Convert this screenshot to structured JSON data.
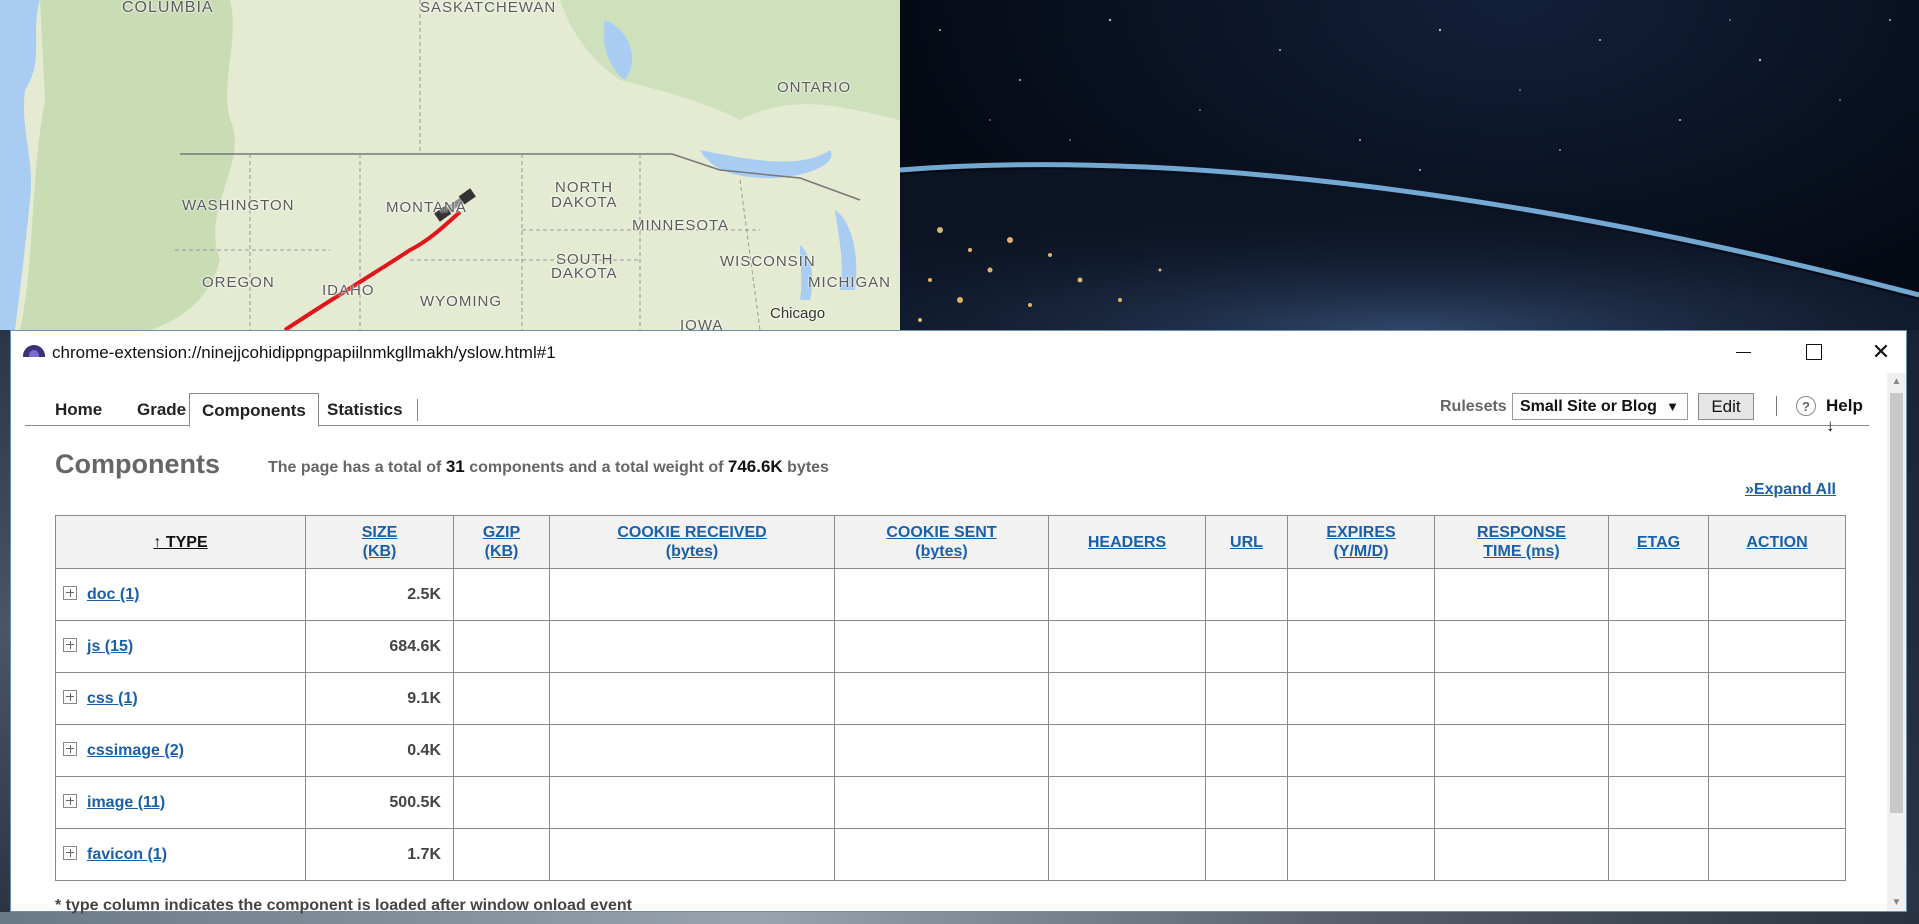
{
  "map": {
    "labels": {
      "columbia": "COLUMBIA",
      "saskatchewan": "SASKATCHEWAN",
      "ontario": "ONTARIO",
      "washington": "WASHINGTON",
      "montana": "MONTANA",
      "north_dakota_1": "NORTH",
      "north_dakota_2": "DAKOTA",
      "minnesota": "MINNESOTA",
      "south_dakota_1": "SOUTH",
      "south_dakota_2": "DAKOTA",
      "wisconsin": "WISCONSIN",
      "oregon": "OREGON",
      "idaho": "IDAHO",
      "wyoming": "WYOMING",
      "michigan": "MICHIGAN",
      "iowa": "IOWA",
      "chicago": "Chicago"
    }
  },
  "window": {
    "title": "chrome-extension://ninejjcohidippngpapiilnmkgllmakh/yslow.html#1",
    "controls": {
      "minimize": "",
      "maximize": "",
      "close": "✕"
    }
  },
  "tabs": {
    "home": "Home",
    "grade": "Grade",
    "components": "Components",
    "statistics": "Statistics"
  },
  "toolbar": {
    "rulesets_label": "Rulesets",
    "ruleset_selected": "Small Site or Blog",
    "ruleset_arrow": "▼",
    "edit_label": "Edit",
    "help_icon": "?",
    "help_label": "Help ↓"
  },
  "content": {
    "title": "Components",
    "summary_prefix": "The page has a total of",
    "component_count": "31",
    "summary_mid": "components and a total weight of",
    "total_weight": "746.6K",
    "summary_suffix": "bytes",
    "expand_all": "»Expand All",
    "footnote": "* type column indicates the component is loaded after window onload event"
  },
  "table": {
    "headers": {
      "type": "↑ TYPE",
      "size_1": "SIZE",
      "size_2": "(KB)",
      "gzip_1": "GZIP",
      "gzip_2": "(KB)",
      "cookie_received_1": "COOKIE RECEIVED",
      "cookie_received_2": "(bytes)",
      "cookie_sent_1": "COOKIE SENT",
      "cookie_sent_2": "(bytes)",
      "headers": "HEADERS",
      "url": "URL",
      "expires_1": "EXPIRES",
      "expires_2": "(Y/M/D)",
      "response_1": "RESPONSE",
      "response_2": "TIME (ms)",
      "etag": "ETAG",
      "action": "ACTION"
    },
    "rows": [
      {
        "type": "doc (1)",
        "size": "2.5K"
      },
      {
        "type": "js (15)",
        "size": "684.6K"
      },
      {
        "type": "css (1)",
        "size": "9.1K"
      },
      {
        "type": "cssimage (2)",
        "size": "0.4K"
      },
      {
        "type": "image (11)",
        "size": "500.5K"
      },
      {
        "type": "favicon (1)",
        "size": "1.7K"
      }
    ]
  },
  "colors": {
    "link": "#1a5fa8",
    "header_bg": "#f2f2f2",
    "border": "#8a8a8a",
    "track_red": "#e0161c"
  }
}
